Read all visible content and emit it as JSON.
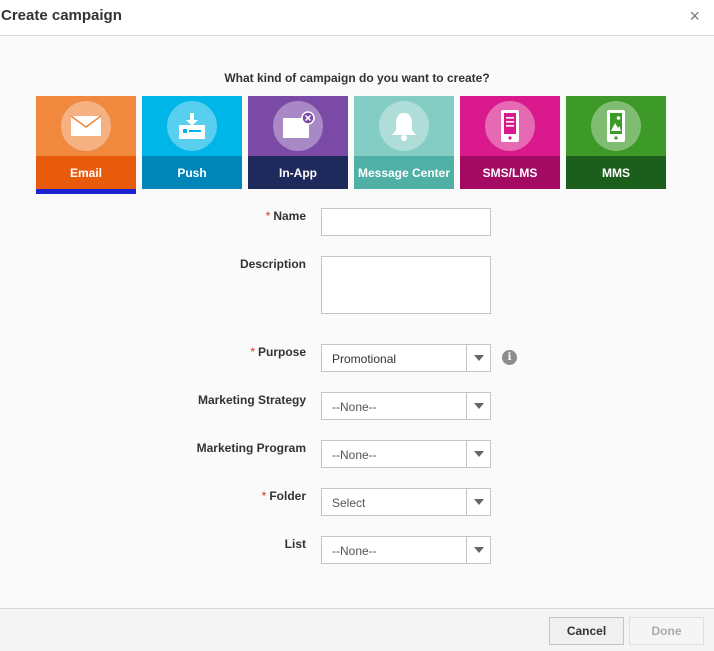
{
  "dialog": {
    "title": "Create campaign",
    "close_glyph": "×"
  },
  "question": "What kind of campaign do you want to create?",
  "campaign_types": [
    {
      "label": "Email",
      "icon": "envelope-icon",
      "top_color": "#f0883e",
      "bottom_color": "#e85a0c",
      "selected": true
    },
    {
      "label": "Push",
      "icon": "push-notification-icon",
      "top_color": "#00b5e8",
      "bottom_color": "#0085b8"
    },
    {
      "label": "In-App",
      "icon": "in-app-message-icon",
      "top_color": "#7b4aa6",
      "bottom_color": "#1f2a5c"
    },
    {
      "label": "Message Center",
      "icon": "bell-icon",
      "top_color": "#84cdc4",
      "bottom_color": "#4fb0a5"
    },
    {
      "label": "SMS/LMS",
      "icon": "mobile-message-icon",
      "top_color": "#d9198c",
      "bottom_color": "#a30b63"
    },
    {
      "label": "MMS",
      "icon": "mobile-image-icon",
      "top_color": "#3d9a28",
      "bottom_color": "#1c5e1c"
    }
  ],
  "form": {
    "required_mark": "*",
    "name_label": "Name",
    "description_label": "Description",
    "purpose_label": "Purpose",
    "purpose_value": "Promotional",
    "info_glyph": "i",
    "marketing_strategy_label": "Marketing Strategy",
    "marketing_strategy_value": "--None--",
    "marketing_program_label": "Marketing Program",
    "marketing_program_value": "--None--",
    "folder_label": "Folder",
    "folder_value": "Select",
    "list_label": "List",
    "list_value": "--None--"
  },
  "footer": {
    "cancel_label": "Cancel",
    "done_label": "Done"
  }
}
